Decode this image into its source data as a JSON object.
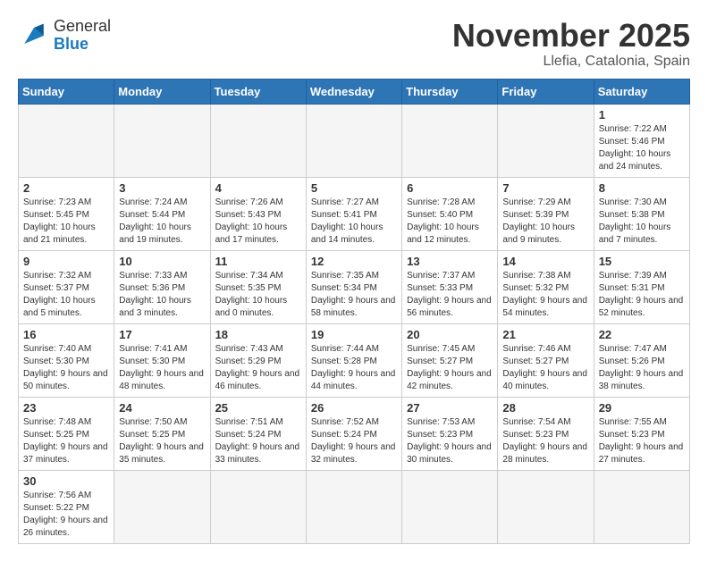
{
  "header": {
    "logo_line1": "General",
    "logo_line2": "Blue",
    "month_title": "November 2025",
    "location": "Llefia, Catalonia, Spain"
  },
  "weekdays": [
    "Sunday",
    "Monday",
    "Tuesday",
    "Wednesday",
    "Thursday",
    "Friday",
    "Saturday"
  ],
  "weeks": [
    [
      {
        "day": "",
        "info": ""
      },
      {
        "day": "",
        "info": ""
      },
      {
        "day": "",
        "info": ""
      },
      {
        "day": "",
        "info": ""
      },
      {
        "day": "",
        "info": ""
      },
      {
        "day": "",
        "info": ""
      },
      {
        "day": "1",
        "info": "Sunrise: 7:22 AM\nSunset: 5:46 PM\nDaylight: 10 hours and 24 minutes."
      }
    ],
    [
      {
        "day": "2",
        "info": "Sunrise: 7:23 AM\nSunset: 5:45 PM\nDaylight: 10 hours and 21 minutes."
      },
      {
        "day": "3",
        "info": "Sunrise: 7:24 AM\nSunset: 5:44 PM\nDaylight: 10 hours and 19 minutes."
      },
      {
        "day": "4",
        "info": "Sunrise: 7:26 AM\nSunset: 5:43 PM\nDaylight: 10 hours and 17 minutes."
      },
      {
        "day": "5",
        "info": "Sunrise: 7:27 AM\nSunset: 5:41 PM\nDaylight: 10 hours and 14 minutes."
      },
      {
        "day": "6",
        "info": "Sunrise: 7:28 AM\nSunset: 5:40 PM\nDaylight: 10 hours and 12 minutes."
      },
      {
        "day": "7",
        "info": "Sunrise: 7:29 AM\nSunset: 5:39 PM\nDaylight: 10 hours and 9 minutes."
      },
      {
        "day": "8",
        "info": "Sunrise: 7:30 AM\nSunset: 5:38 PM\nDaylight: 10 hours and 7 minutes."
      }
    ],
    [
      {
        "day": "9",
        "info": "Sunrise: 7:32 AM\nSunset: 5:37 PM\nDaylight: 10 hours and 5 minutes."
      },
      {
        "day": "10",
        "info": "Sunrise: 7:33 AM\nSunset: 5:36 PM\nDaylight: 10 hours and 3 minutes."
      },
      {
        "day": "11",
        "info": "Sunrise: 7:34 AM\nSunset: 5:35 PM\nDaylight: 10 hours and 0 minutes."
      },
      {
        "day": "12",
        "info": "Sunrise: 7:35 AM\nSunset: 5:34 PM\nDaylight: 9 hours and 58 minutes."
      },
      {
        "day": "13",
        "info": "Sunrise: 7:37 AM\nSunset: 5:33 PM\nDaylight: 9 hours and 56 minutes."
      },
      {
        "day": "14",
        "info": "Sunrise: 7:38 AM\nSunset: 5:32 PM\nDaylight: 9 hours and 54 minutes."
      },
      {
        "day": "15",
        "info": "Sunrise: 7:39 AM\nSunset: 5:31 PM\nDaylight: 9 hours and 52 minutes."
      }
    ],
    [
      {
        "day": "16",
        "info": "Sunrise: 7:40 AM\nSunset: 5:30 PM\nDaylight: 9 hours and 50 minutes."
      },
      {
        "day": "17",
        "info": "Sunrise: 7:41 AM\nSunset: 5:30 PM\nDaylight: 9 hours and 48 minutes."
      },
      {
        "day": "18",
        "info": "Sunrise: 7:43 AM\nSunset: 5:29 PM\nDaylight: 9 hours and 46 minutes."
      },
      {
        "day": "19",
        "info": "Sunrise: 7:44 AM\nSunset: 5:28 PM\nDaylight: 9 hours and 44 minutes."
      },
      {
        "day": "20",
        "info": "Sunrise: 7:45 AM\nSunset: 5:27 PM\nDaylight: 9 hours and 42 minutes."
      },
      {
        "day": "21",
        "info": "Sunrise: 7:46 AM\nSunset: 5:27 PM\nDaylight: 9 hours and 40 minutes."
      },
      {
        "day": "22",
        "info": "Sunrise: 7:47 AM\nSunset: 5:26 PM\nDaylight: 9 hours and 38 minutes."
      }
    ],
    [
      {
        "day": "23",
        "info": "Sunrise: 7:48 AM\nSunset: 5:25 PM\nDaylight: 9 hours and 37 minutes."
      },
      {
        "day": "24",
        "info": "Sunrise: 7:50 AM\nSunset: 5:25 PM\nDaylight: 9 hours and 35 minutes."
      },
      {
        "day": "25",
        "info": "Sunrise: 7:51 AM\nSunset: 5:24 PM\nDaylight: 9 hours and 33 minutes."
      },
      {
        "day": "26",
        "info": "Sunrise: 7:52 AM\nSunset: 5:24 PM\nDaylight: 9 hours and 32 minutes."
      },
      {
        "day": "27",
        "info": "Sunrise: 7:53 AM\nSunset: 5:23 PM\nDaylight: 9 hours and 30 minutes."
      },
      {
        "day": "28",
        "info": "Sunrise: 7:54 AM\nSunset: 5:23 PM\nDaylight: 9 hours and 28 minutes."
      },
      {
        "day": "29",
        "info": "Sunrise: 7:55 AM\nSunset: 5:23 PM\nDaylight: 9 hours and 27 minutes."
      }
    ],
    [
      {
        "day": "30",
        "info": "Sunrise: 7:56 AM\nSunset: 5:22 PM\nDaylight: 9 hours and 26 minutes."
      },
      {
        "day": "",
        "info": ""
      },
      {
        "day": "",
        "info": ""
      },
      {
        "day": "",
        "info": ""
      },
      {
        "day": "",
        "info": ""
      },
      {
        "day": "",
        "info": ""
      },
      {
        "day": "",
        "info": ""
      }
    ]
  ]
}
